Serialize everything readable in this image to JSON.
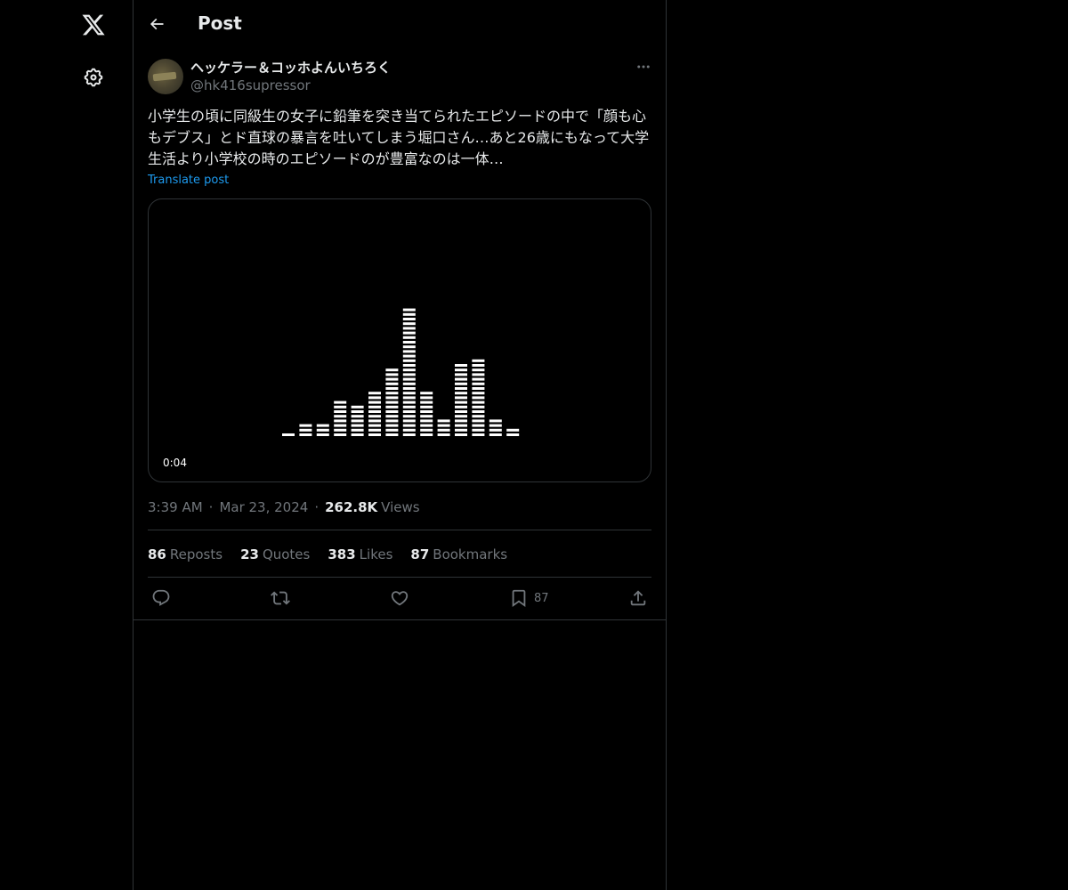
{
  "nav": {
    "logo_icon": "x-logo-icon",
    "settings_icon": "gear-icon"
  },
  "header": {
    "title": "Post",
    "back_icon": "arrow-left-icon"
  },
  "post": {
    "author": {
      "display_name": "ヘッケラー＆コッホよんいちろく",
      "handle": "@hk416supressor"
    },
    "text": "小学生の頃に同級生の女子に鉛筆を突き当てられたエピソードの中で「顔も心もデブス」とド直球の暴言を吐いてしまう堀口さん…あと26歳にもなって大学生活より小学校の時のエピソードのが豊富なのは一体…",
    "translate_label": "Translate post",
    "media": {
      "duration": "0:04",
      "equalizer_levels": [
        1,
        3,
        3,
        8,
        7,
        10,
        15,
        28,
        10,
        4,
        16,
        17,
        4,
        2
      ]
    },
    "time": "3:39 AM",
    "date": "Mar 23, 2024",
    "views_count": "262.8K",
    "views_label": "Views"
  },
  "stats": {
    "reposts_count": "86",
    "reposts_label": "Reposts",
    "quotes_count": "23",
    "quotes_label": "Quotes",
    "likes_count": "383",
    "likes_label": "Likes",
    "bookmarks_count": "87",
    "bookmarks_label": "Bookmarks"
  },
  "actions": {
    "bookmark_count": "87"
  },
  "colors": {
    "background": "#000000",
    "text": "#e7e9ea",
    "muted": "#71767b",
    "link": "#1d9bf0",
    "border": "#2f3336"
  }
}
